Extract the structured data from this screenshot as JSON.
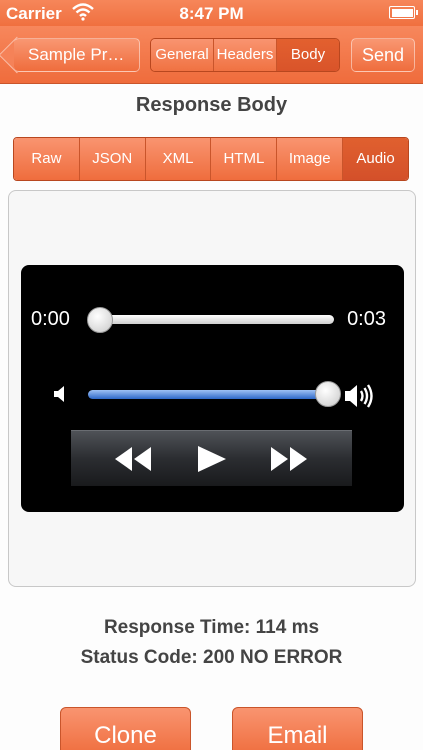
{
  "status_bar": {
    "carrier": "Carrier",
    "time": "8:47 PM"
  },
  "nav": {
    "back_label": "Sample Pr…",
    "segments": [
      {
        "label": "General"
      },
      {
        "label": "Headers"
      },
      {
        "label": "Body",
        "active": true
      }
    ],
    "send_label": "Send"
  },
  "section_title": "Response Body",
  "formats": [
    {
      "label": "Raw"
    },
    {
      "label": "JSON"
    },
    {
      "label": "XML"
    },
    {
      "label": "HTML"
    },
    {
      "label": "Image"
    },
    {
      "label": "Audio",
      "active": true
    }
  ],
  "player": {
    "current_time": "0:00",
    "duration": "0:03",
    "progress": 0,
    "volume": 1.0
  },
  "info": {
    "response_time": "Response Time: 114 ms",
    "status_code": "Status Code: 200 NO ERROR"
  },
  "actions": {
    "clone_label": "Clone",
    "email_label": "Email"
  },
  "colors": {
    "accent": "#f07242",
    "accent_dark": "#d9542a",
    "volume_blue": "#2e68c8"
  }
}
